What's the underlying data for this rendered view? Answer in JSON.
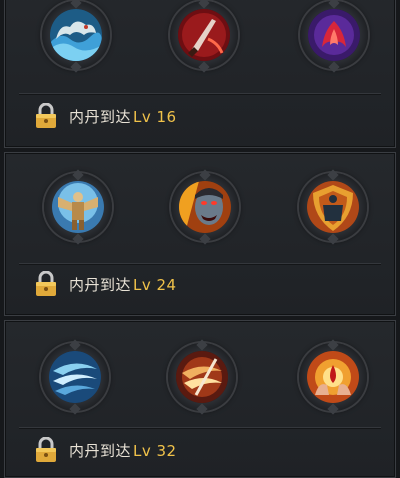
{
  "sections": [
    {
      "requirement_prefix": "内丹到达",
      "requirement_level": "Lv 16",
      "skills": [
        {
          "icon": "water-dragon-wave-icon"
        },
        {
          "icon": "red-dagger-slash-icon"
        },
        {
          "icon": "crimson-phoenix-flame-icon"
        }
      ]
    },
    {
      "requirement_prefix": "内丹到达",
      "requirement_level": "Lv 24",
      "skills": [
        {
          "icon": "golden-armored-warrior-icon"
        },
        {
          "icon": "roaring-vampire-face-icon"
        },
        {
          "icon": "guardian-shield-figure-icon"
        }
      ]
    },
    {
      "requirement_prefix": "内丹到达",
      "requirement_level": "Lv 32",
      "skills": [
        {
          "icon": "blue-whirlwind-icon"
        },
        {
          "icon": "fire-tornado-slash-icon"
        },
        {
          "icon": "blood-drop-hands-icon"
        }
      ]
    }
  ],
  "colors": {
    "background": "#16181b",
    "panel": "#23262a",
    "text": "#e8e2d6",
    "level_text": "#f0c24a"
  }
}
